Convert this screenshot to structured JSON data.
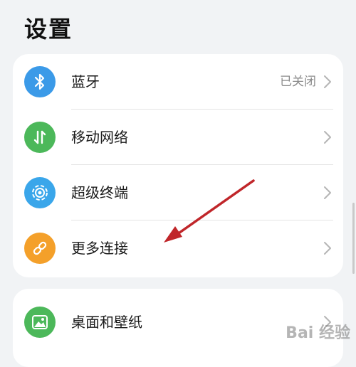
{
  "page": {
    "title": "设置"
  },
  "items": [
    {
      "label": "蓝牙",
      "value": "已关闭",
      "icon": "bluetooth-icon",
      "color": "#3b9ae8"
    },
    {
      "label": "移动网络",
      "value": "",
      "icon": "mobile-data-icon",
      "color": "#4cb85a"
    },
    {
      "label": "超级终端",
      "value": "",
      "icon": "super-device-icon",
      "color": "#3aa6ea"
    },
    {
      "label": "更多连接",
      "value": "",
      "icon": "link-icon",
      "color": "#f4a02a"
    },
    {
      "label": "桌面和壁纸",
      "value": "",
      "icon": "wallpaper-icon",
      "color": "#4cb85a"
    }
  ],
  "watermark": {
    "text": "Bai 经验"
  },
  "colors": {
    "background": "#f1f3f5",
    "annotation_arrow": "#c0262a"
  }
}
